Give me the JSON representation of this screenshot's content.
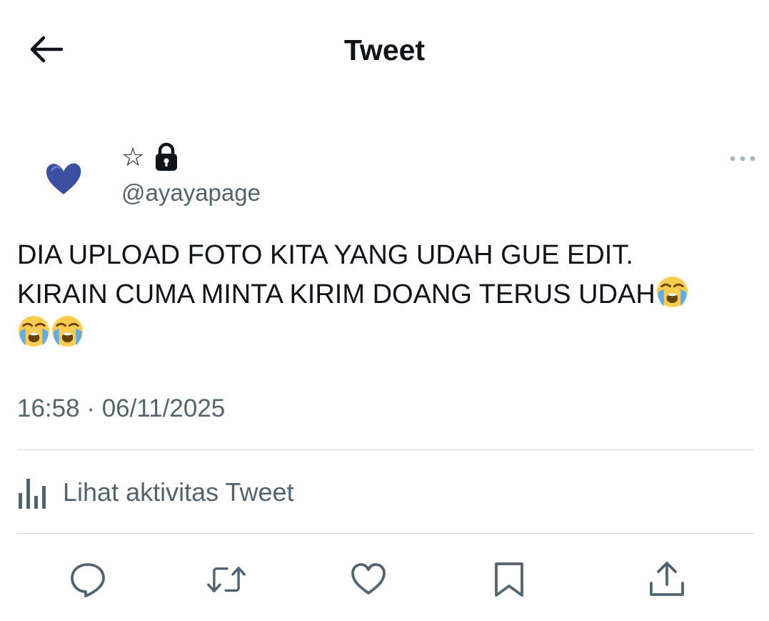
{
  "header": {
    "title": "Tweet",
    "back_icon": "arrow-left-icon"
  },
  "author": {
    "avatar_icon": "blue-heart-icon",
    "display_name": "☆",
    "lock_icon": "lock-icon",
    "handle": "@ayayapage"
  },
  "more_icon": "more-horizontal-icon",
  "tweet": {
    "line1": "DIA UPLOAD FOTO KITA YANG UDAH GUE EDIT.",
    "line2": "KIRAIN CUMA MINTA KIRIM DOANG TERUS UDAH",
    "emoji": "loudly-crying-face-emoji",
    "timestamp": "16:58 · 06/11/2025"
  },
  "activity": {
    "label": "Lihat aktivitas Tweet",
    "icon": "bar-chart-icon"
  },
  "actions": [
    {
      "name": "reply",
      "icon": "reply-icon"
    },
    {
      "name": "retweet",
      "icon": "retweet-icon"
    },
    {
      "name": "like",
      "icon": "heart-icon"
    },
    {
      "name": "bookmark",
      "icon": "bookmark-icon"
    },
    {
      "name": "share",
      "icon": "share-icon"
    }
  ],
  "colors": {
    "text": "#0f1419",
    "secondary": "#536471",
    "divider": "#cfd9de",
    "avatar_heart": "#3b4fa0"
  }
}
